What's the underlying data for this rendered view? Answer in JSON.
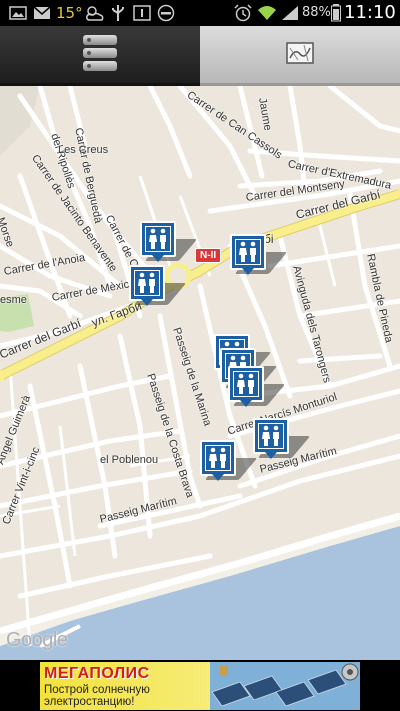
{
  "status_bar": {
    "temperature": "15°",
    "battery_percent": "88%",
    "time": "11:10"
  },
  "tabs": [
    {
      "name": "list",
      "icon": "list-icon",
      "selected": true
    },
    {
      "name": "map",
      "icon": "map-icon",
      "selected": false
    }
  ],
  "map": {
    "attribution": "Google",
    "road_shield": "N-II",
    "streets": [
      "Carrer de Berguedà",
      "del Ripollès",
      "Les Creus",
      "Carrer de Jacinto Benavente",
      "Carrer de Can Cassols",
      "Jaume",
      "Carrer d'Extremadura",
      "Carrer del Montseny",
      "Carrer del Garbí",
      "Carrer de l'Anoia",
      "Carrer de Mèxic",
      "ул. Гарби",
      "Carrer del Garbí",
      "Passeig de la Marina",
      "Passeig de la Costa Brava",
      "Avinguda dels Tarongers",
      "Rambla de Pineda",
      "Carrer Narcís Monturiol",
      "el Poblenou",
      "Passeig Marítim",
      "Passeig Marítim",
      "Angel Guimerà",
      "Carrer Vint-i-cinc",
      "Morse",
      "esme",
      "Carrer de C",
      "бі"
    ],
    "markers_count": 7,
    "marker_icon": "restroom-icon",
    "colors": {
      "land": "#ece6dc",
      "road": "#ffffff",
      "main_road": "#f8ef8c",
      "sea": "#a9c2de",
      "marker": "#1d5fa3"
    }
  },
  "ad": {
    "title": "МЕГАПОЛИС",
    "text": "Построй солнечную электростанцию!"
  }
}
